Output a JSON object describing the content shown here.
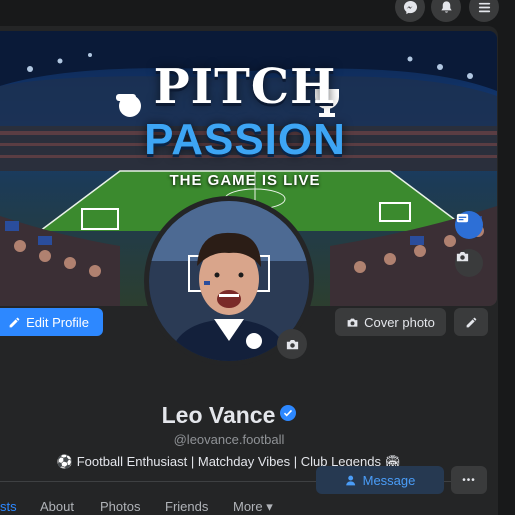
{
  "topbar": {
    "icons": [
      "messenger-icon",
      "bell-icon",
      "menu-icon"
    ]
  },
  "cover": {
    "logo_title": "PITCH",
    "logo_subtitle": "PASSION",
    "tagline": "THE GAME IS LIVE",
    "cover_photo_label": "Cover photo"
  },
  "profile": {
    "edit_label": "Edit Profile",
    "name": "Leo Vance",
    "handle": "@leovance.football",
    "bio": "⚽ Football Enthusiast | Matchday Vibes | Club Legends 🏟"
  },
  "tabs": {
    "posts": "sts",
    "about": "About",
    "photos": "Photos",
    "friends": "Friends",
    "more": "More ▾"
  },
  "actions": {
    "message_label": "Message",
    "more_label": "•••"
  },
  "colors": {
    "accent": "#2d88ff",
    "card": "#242526",
    "background": "#18191a",
    "button": "#3a3b3c",
    "notification": "#e41e3f",
    "logo_blue": "#3da5f4"
  }
}
